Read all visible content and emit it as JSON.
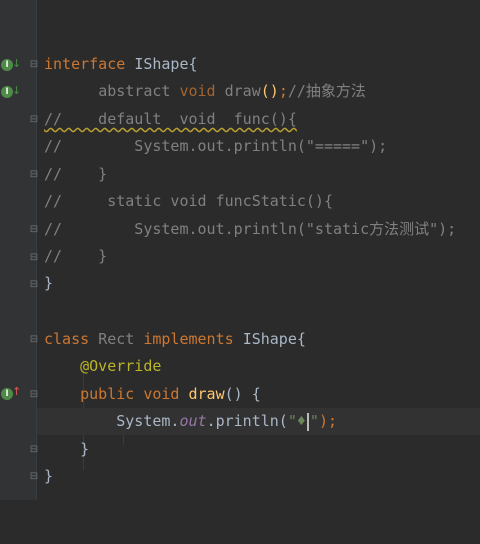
{
  "editor": {
    "lines": {
      "l1": {
        "kw": "interface",
        "name": "IShape{"
      },
      "l2": {
        "abs": "abstract",
        "kw": "void",
        "fn": "draw",
        "paren": "()",
        "semi": ";",
        "comment": "//抽象方法"
      },
      "l3": {
        "text": "//    default  void  func(){"
      },
      "l4": {
        "text": "//        System.out.println(\"=====\");"
      },
      "l5": {
        "text": "//    }"
      },
      "l6": {
        "text": "//     static void funcStatic(){"
      },
      "l7": {
        "text": "//        System.out.println(\"static方法测试\");"
      },
      "l8": {
        "text": "//    }"
      },
      "l9": {
        "text": "}"
      },
      "l10": {
        "kw": "class",
        "cls": "Rect",
        "kw2": "implements",
        "iface": "IShape{"
      },
      "l11": {
        "ann": "@Override"
      },
      "l12": {
        "kw": "public void",
        "fn": "draw",
        "rest": "() {"
      },
      "l13": {
        "sys": "System.",
        "out": "out",
        "call": ".println(",
        "str_open": "\"",
        "str_glyph": "♦",
        "str_close": "\"",
        "end": ");"
      },
      "l14": {
        "text": "}"
      },
      "l15": {
        "text": "}"
      }
    }
  },
  "gutter": {
    "impl_marker": "I",
    "down_arrow": "↓",
    "up_arrow": "↑"
  },
  "colors": {
    "background": "#2b2b2b",
    "keyword": "#cc7832",
    "string": "#6a8759",
    "comment": "#808080",
    "annotation": "#bbb529",
    "function_decl": "#ffc66d",
    "field": "#9876aa"
  }
}
